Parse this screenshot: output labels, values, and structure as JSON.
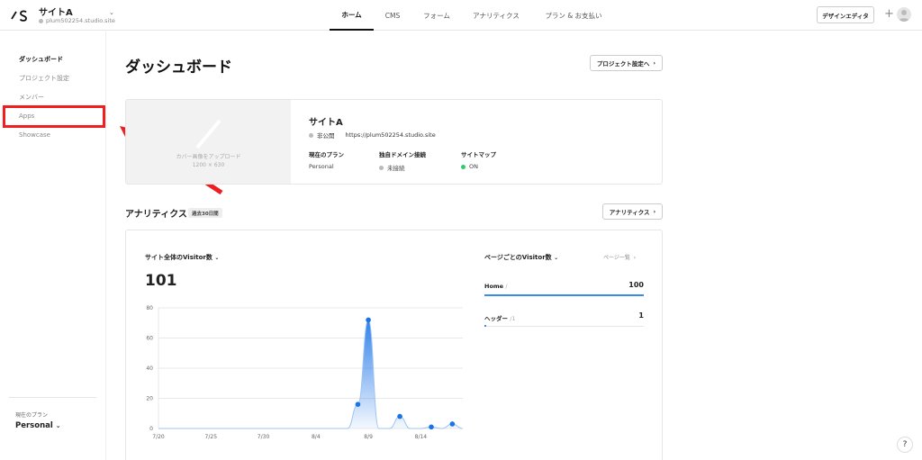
{
  "header": {
    "site_name": "サイトA",
    "site_url": "plum502254.studio.site",
    "nav": [
      {
        "label": "ホーム",
        "active": true
      },
      {
        "label": "CMS",
        "active": false
      },
      {
        "label": "フォーム",
        "active": false
      },
      {
        "label": "アナリティクス",
        "active": false
      },
      {
        "label": "プラン & お支払い",
        "active": false
      }
    ],
    "design_editor_label": "デザインエディタ",
    "plus_glyph": "+"
  },
  "sidebar": {
    "items": [
      {
        "label": "ダッシュボード",
        "active": true
      },
      {
        "label": "プロジェクト設定",
        "active": false
      },
      {
        "label": "メンバー",
        "active": false
      },
      {
        "label": "Apps",
        "active": false
      },
      {
        "label": "Showcase",
        "active": false
      }
    ],
    "plan_label": "現在のプラン",
    "plan_value": "Personal"
  },
  "main": {
    "title": "ダッシュボード",
    "project_settings_button": "プロジェクト設定へ",
    "project": {
      "cover_upload_text": "カバー画像をアップロード",
      "cover_size": "1200 × 630",
      "name": "サイトA",
      "visibility": "非公開",
      "url": "https://plum502254.studio.site",
      "plan_label": "現在のプラン",
      "plan_value": "Personal",
      "domain_label": "独自ドメイン接続",
      "domain_value": "未接続",
      "sitemap_label": "サイトマップ",
      "sitemap_value": "ON"
    },
    "analytics": {
      "title": "アナリティクス",
      "period": "過去30日間",
      "button": "アナリティクス",
      "visitors_title": "サイト全体のVisitor数",
      "visitors_total": "101",
      "pages_title": "ページごとのVisitor数",
      "pages_link": "ページ一覧",
      "pages": [
        {
          "label": "Home",
          "suffix": "/",
          "value": "100",
          "fraction": 1.0
        },
        {
          "label": "ヘッダー",
          "suffix": "/1",
          "value": "1",
          "fraction": 0.01
        }
      ]
    }
  },
  "colors": {
    "accent": "#1a73e8",
    "sitemap_on": "#2ecc71",
    "annotation": "#f01e1e"
  },
  "chart_data": {
    "type": "area",
    "title": "サイト全体のVisitor数",
    "x_ticks": [
      "7/20",
      "7/25",
      "7/30",
      "8/4",
      "8/9",
      "8/14"
    ],
    "y_ticks": [
      0,
      20,
      40,
      60,
      80
    ],
    "ylim": [
      0,
      80
    ],
    "x_day_range": [
      0,
      29
    ],
    "series": [
      {
        "points": [
          {
            "day": 19,
            "value": 16
          },
          {
            "day": 20,
            "value": 72
          },
          {
            "day": 23,
            "value": 8
          },
          {
            "day": 26,
            "value": 1
          },
          {
            "day": 28,
            "value": 3
          }
        ]
      }
    ]
  }
}
